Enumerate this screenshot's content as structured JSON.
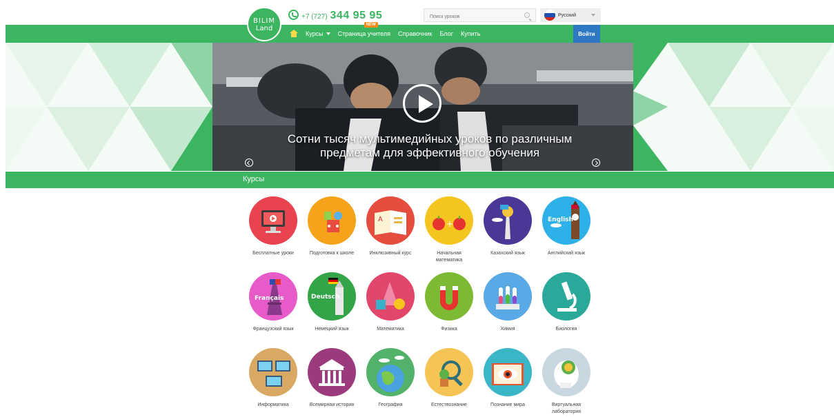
{
  "header": {
    "logo_line1": "BILIM",
    "logo_line2": "Land",
    "phone_code": "+7 (727)",
    "phone_number": "344 95 95",
    "search_placeholder": "Поиск уроков",
    "language": "Русский"
  },
  "nav": {
    "items": [
      {
        "label": "Курсы",
        "has_dropdown": true
      },
      {
        "label": "Страница учителя",
        "badge": "NEW"
      },
      {
        "label": "Справочник"
      },
      {
        "label": "Блог"
      },
      {
        "label": "Купить"
      }
    ],
    "login_label": "Войти"
  },
  "hero": {
    "title_line1": "Сотни тысяч мультимедийных уроков по различным",
    "title_line2": "предметам для эффективного обучения"
  },
  "courses": {
    "section_title": "Курсы",
    "items": [
      {
        "label": "Бесплатные уроки",
        "color": "#e8434f",
        "icon": "monitor-icon"
      },
      {
        "label": "Подготовка к школе",
        "color": "#f7a21b",
        "icon": "toys-icon"
      },
      {
        "label": "Инклюзивный курс",
        "color": "#e54d3f",
        "icon": "book-icon"
      },
      {
        "label": "Начальная математика",
        "color": "#f3c51e",
        "icon": "apples-icon"
      },
      {
        "label": "Казахский язык",
        "color": "#4b3896",
        "icon": "baiterek-icon"
      },
      {
        "label": "Английский язык",
        "color": "#2eb0e8",
        "icon": "big-ben-icon",
        "text": "English"
      },
      {
        "label": "Французский язык",
        "color": "#e65bc8",
        "icon": "eiffel-tower-icon",
        "text": "Français"
      },
      {
        "label": "Немецкий язык",
        "color": "#33a447",
        "icon": "german-tower-icon",
        "text": "Deutsch"
      },
      {
        "label": "Математика",
        "color": "#e2466a",
        "icon": "shapes-icon"
      },
      {
        "label": "Физика",
        "color": "#7cba34",
        "icon": "magnet-icon"
      },
      {
        "label": "Химия",
        "color": "#58a9e6",
        "icon": "test-tubes-icon"
      },
      {
        "label": "Биология",
        "color": "#2aa89a",
        "icon": "microscope-icon"
      },
      {
        "label": "Информатика",
        "color": "#d9a862",
        "icon": "computers-icon"
      },
      {
        "label": "Всемирная история",
        "color": "#9b3b7e",
        "icon": "temple-icon"
      },
      {
        "label": "География",
        "color": "#52b26a",
        "icon": "globe-icon"
      },
      {
        "label": "Естествознание",
        "color": "#f6c355",
        "icon": "magnifier-plant-icon"
      },
      {
        "label": "Познание мира",
        "color": "#3bb6c6",
        "icon": "eye-book-icon"
      },
      {
        "label": "Виртуальная лаборатория",
        "color": "#c9d7e0",
        "icon": "brain-lab-icon"
      }
    ]
  },
  "colors": {
    "brand_green": "#3cb561",
    "login_blue": "#2d77c5",
    "badge_orange": "#ff8a1a"
  }
}
